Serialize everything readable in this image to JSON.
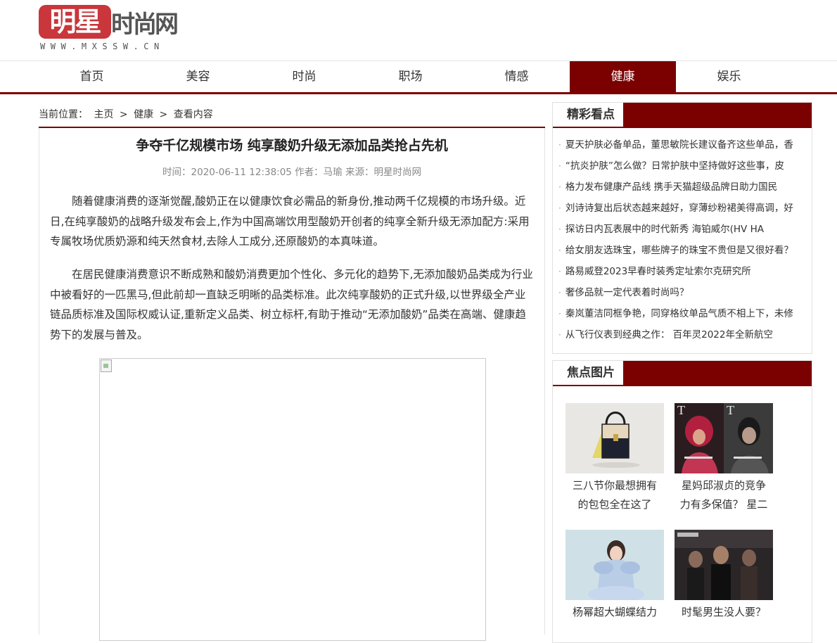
{
  "site": {
    "logo_red": "明星",
    "logo_grey": "时尚网",
    "logo_url": "WWW.MXSSW.CN"
  },
  "nav": {
    "items": [
      {
        "label": "首页"
      },
      {
        "label": "美容"
      },
      {
        "label": "时尚"
      },
      {
        "label": "职场"
      },
      {
        "label": "情感"
      },
      {
        "label": "健康",
        "active": true
      },
      {
        "label": "娱乐"
      }
    ],
    "active_color": "#7b0000"
  },
  "breadcrumb": {
    "prefix": "当前位置：",
    "home": "主页",
    "sep1": ">",
    "category": "健康",
    "sep2": ">",
    "current": "查看内容"
  },
  "article": {
    "title": "争夺千亿规模市场 纯享酸奶升级无添加品类抢占先机",
    "meta": "时间：2020-06-11 12:38:05 作者：马瑜 来源：明星时尚网",
    "paragraphs": [
      "随着健康消费的逐渐觉醒,酸奶正在以健康饮食必需品的新身份,推动两千亿规模的市场升级。近日,在纯享酸奶的战略升级发布会上,作为中国高端饮用型酸奶开创者的纯享全新升级无添加配方:采用专属牧场优质奶源和纯天然食材,去除人工成分,还原酸奶的本真味道。",
      "在居民健康消费意识不断成熟和酸奶消费更加个性化、多元化的趋势下,无添加酸奶品类成为行业中被看好的一匹黑马,但此前却一直缺乏明晰的品类标准。此次纯享酸奶的正式升级,以世界级全产业链品质标准及国际权威认证,重新定义品类、树立标杆,有助于推动“无添加酸奶”品类在高端、健康趋势下的发展与普及。"
    ]
  },
  "sidebar": {
    "hot": {
      "title": "精彩看点",
      "items": [
        "夏天护肤必备单品，董思敏院长建议备齐这些单品，香",
        "“抗炎护肤”怎么做？日常护肤中坚持做好这些事，皮",
        "格力发布健康产品线 携手天猫超级品牌日助力国民",
        "刘诗诗复出后状态越来越好，穿薄纱粉裙美得高调，好",
        "探访日内瓦表展中的时代新秀 海铂威尔(HV HA",
        "给女朋友选珠宝，哪些牌子的珠宝不贵但是又很好看？",
        "路易威登2023早春时装秀定址索尔克研究所",
        "奢侈品就一定代表着时尚吗？",
        "秦岚董洁同框争艳，同穿格纹单品气质不相上下，未修",
        "从飞行仪表到经典之作： 百年灵2022年全新航空"
      ]
    },
    "focus": {
      "title": "焦点图片",
      "items": [
        {
          "caption1": "三八节你最想拥有",
          "caption2": "的包包全在这了",
          "icon": "handbag-photo"
        },
        {
          "caption1": "星妈邱淑贞的竞争",
          "caption2": "力有多保值？ 星二",
          "icon": "magazine-cover-photo"
        },
        {
          "caption1": "杨幂超大蝴蝶结力",
          "caption2": "",
          "icon": "gown-photo"
        },
        {
          "caption1": "时髦男生没人要？",
          "caption2": "",
          "icon": "fashion-show-photo"
        }
      ]
    }
  }
}
